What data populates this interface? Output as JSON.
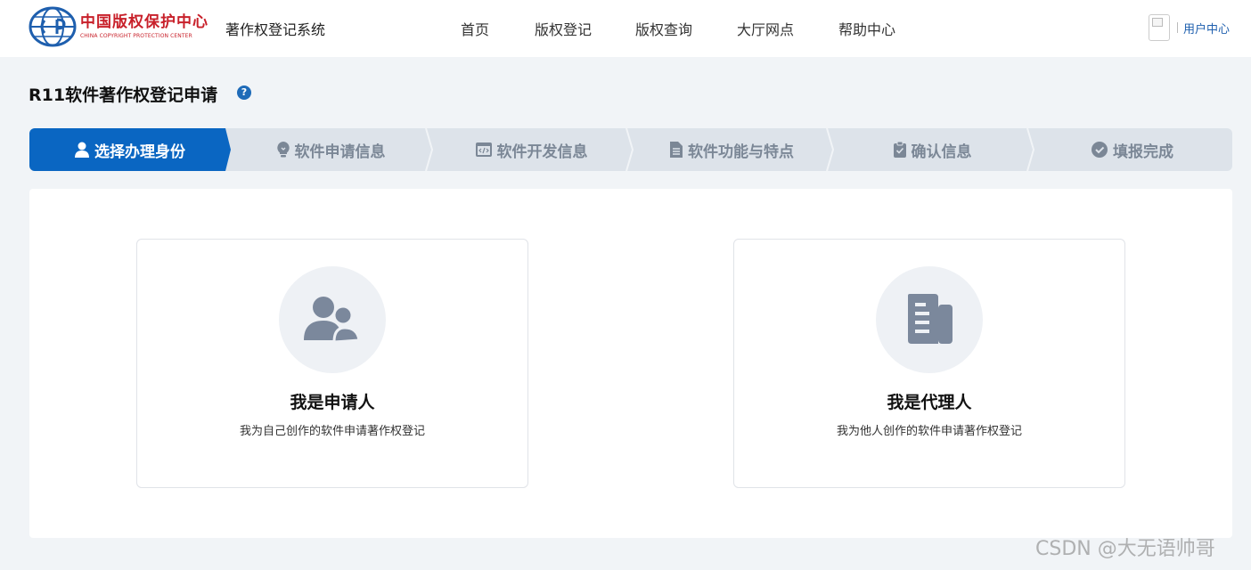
{
  "header": {
    "logo_cn": "中国版权保护中心",
    "logo_en": "CHINA COPYRIGHT PROTECTION CENTER",
    "system_name": "著作权登记系统",
    "nav": [
      "首页",
      "版权登记",
      "版权查询",
      "大厅网点",
      "帮助中心"
    ],
    "user_center": "用户中心"
  },
  "page": {
    "title": "R11软件著作权登记申请"
  },
  "steps": [
    {
      "label": "选择办理身份",
      "icon": "user-icon",
      "active": true
    },
    {
      "label": "软件申请信息",
      "icon": "lightbulb-icon",
      "active": false
    },
    {
      "label": "软件开发信息",
      "icon": "code-window-icon",
      "active": false
    },
    {
      "label": "软件功能与特点",
      "icon": "document-icon",
      "active": false
    },
    {
      "label": "确认信息",
      "icon": "clipboard-icon",
      "active": false
    },
    {
      "label": "填报完成",
      "icon": "check-circle-icon",
      "active": false
    }
  ],
  "cards": [
    {
      "title": "我是申请人",
      "desc": "我为自己创作的软件申请著作权登记",
      "icon": "users-icon"
    },
    {
      "title": "我是代理人",
      "desc": "我为他人创作的软件申请著作权登记",
      "icon": "documents-icon"
    }
  ],
  "watermark": "CSDN @大无语帅哥",
  "colors": {
    "primary": "#0a66c2",
    "step_inactive_bg": "#dde3ea",
    "step_inactive_text": "#7b8796",
    "icon_gray": "#7b889c",
    "logo_red": "#c8202a"
  }
}
